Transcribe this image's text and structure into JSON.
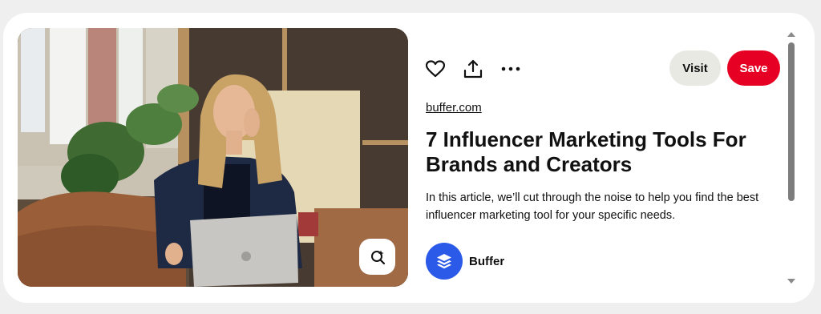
{
  "pin": {
    "photo_alt": "",
    "actions": {
      "like_icon": "heart-icon",
      "share_icon": "share-icon",
      "more_icon": "more-icon"
    },
    "visit_label": "Visit",
    "save_label": "Save",
    "source_link": "buffer.com",
    "title": "7 Influencer Marketing Tools For Brands and Creators",
    "description": "In this article, we’ll cut through the noise to help you find the best influencer marketing tool for your specific needs.",
    "author": {
      "name": "Buffer",
      "avatar_icon": "buffer-logo-icon"
    },
    "visual_search_icon": "visual-search-icon"
  },
  "colors": {
    "save": "#e60023",
    "visit": "#e9e9e4",
    "avatar": "#2b59e8",
    "scrollbar": "#7d7d7d"
  }
}
